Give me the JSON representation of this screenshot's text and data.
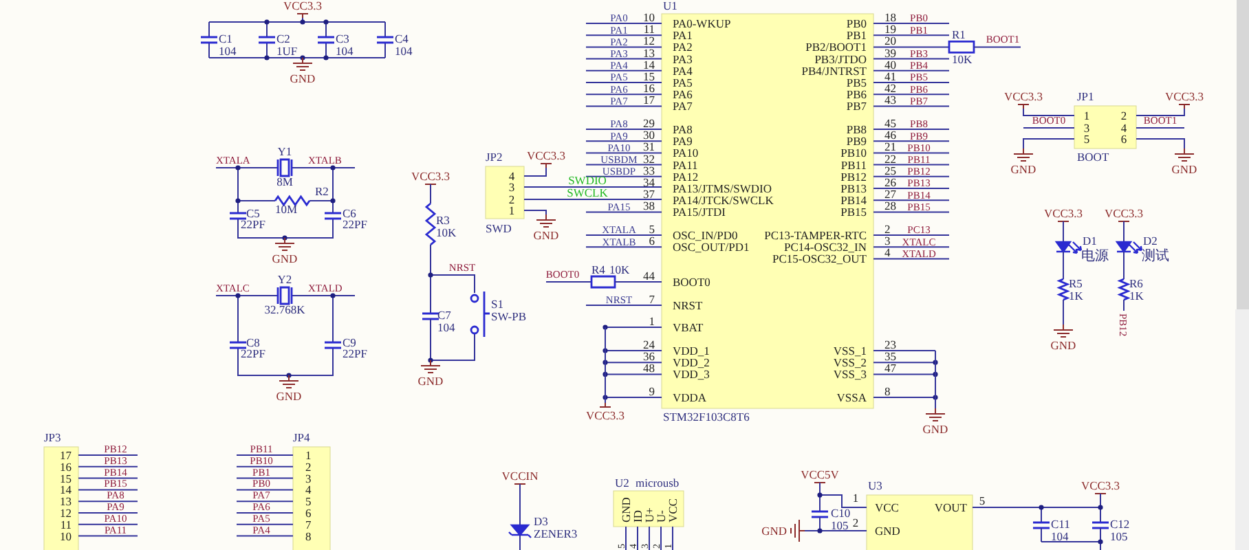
{
  "decoupling": {
    "supply": "VCC3.3",
    "ground": "GND",
    "capacitors": [
      {
        "ref": "C1",
        "value": "104"
      },
      {
        "ref": "C2",
        "value": "1UF"
      },
      {
        "ref": "C3",
        "value": "104"
      },
      {
        "ref": "C4",
        "value": "104"
      }
    ]
  },
  "oscillators": [
    {
      "nets": [
        "XTALA",
        "XTALB"
      ],
      "crystal": {
        "ref": "Y1",
        "value": "8M"
      },
      "resistor": {
        "ref": "R2",
        "value": "10M"
      },
      "capacitors": [
        {
          "ref": "C5",
          "value": "22PF"
        },
        {
          "ref": "C6",
          "value": "22PF"
        }
      ],
      "ground": "GND"
    },
    {
      "nets": [
        "XTALC",
        "XTALD"
      ],
      "crystal": {
        "ref": "Y2",
        "value": "32.768K"
      },
      "capacitors": [
        {
          "ref": "C8",
          "value": "22PF"
        },
        {
          "ref": "C9",
          "value": "22PF"
        }
      ],
      "ground": "GND"
    }
  ],
  "reset": {
    "supply": "VCC3.3",
    "resistor": {
      "ref": "R3",
      "value": "10K"
    },
    "net": "NRST",
    "capacitor": {
      "ref": "C7",
      "value": "104"
    },
    "switch": {
      "ref": "S1",
      "value": "SW-PB"
    },
    "ground": "GND"
  },
  "swd": {
    "ref": "JP2",
    "name": "SWD",
    "supply": "VCC3.3",
    "ground": "GND",
    "pins": [
      "4",
      "3",
      "2",
      "1"
    ],
    "nets": [
      "SWDIO",
      "SWCLK"
    ]
  },
  "mcu": {
    "ref": "U1",
    "part": "STM32F103C8T6",
    "supply": "VCC3.3",
    "ground": "GND",
    "left_groups": [
      [
        {
          "name": "PA0-WKUP",
          "number": "10",
          "net": "PA0"
        },
        {
          "name": "PA1",
          "number": "11",
          "net": "PA1"
        },
        {
          "name": "PA2",
          "number": "12",
          "net": "PA2"
        },
        {
          "name": "PA3",
          "number": "13",
          "net": "PA3"
        },
        {
          "name": "PA4",
          "number": "14",
          "net": "PA4"
        },
        {
          "name": "PA5",
          "number": "15",
          "net": "PA5"
        },
        {
          "name": "PA6",
          "number": "16",
          "net": "PA6"
        },
        {
          "name": "PA7",
          "number": "17",
          "net": "PA7"
        }
      ],
      [
        {
          "name": "PA8",
          "number": "29",
          "net": "PA8"
        },
        {
          "name": "PA9",
          "number": "30",
          "net": "PA9"
        },
        {
          "name": "PA10",
          "number": "31",
          "net": "PA10"
        },
        {
          "name": "PA11",
          "number": "32",
          "net": "USBDM"
        },
        {
          "name": "PA12",
          "number": "33",
          "net": "USBDP"
        },
        {
          "name": "PA13/JTMS/SWDIO",
          "number": "34"
        },
        {
          "name": "PA14/JTCK/SWCLK",
          "number": "37"
        },
        {
          "name": "PA15/JTDI",
          "number": "38",
          "net": "PA15"
        }
      ],
      [
        {
          "name": "OSC_IN/PD0",
          "number": "5",
          "net": "XTALA"
        },
        {
          "name": "OSC_OUT/PD1",
          "number": "6",
          "net": "XTALB"
        }
      ],
      [
        {
          "name": "BOOT0",
          "number": "44",
          "resistor": {
            "ref": "R4",
            "value": "10K",
            "net": "BOOT0"
          }
        }
      ],
      [
        {
          "name": "NRST",
          "number": "7",
          "net": "NRST"
        }
      ]
    ],
    "supply_pin_groups": [
      [
        {
          "name": "VBAT",
          "number": "1"
        }
      ],
      [
        {
          "name": "VDD_1",
          "number": "24"
        },
        {
          "name": "VDD_2",
          "number": "36"
        },
        {
          "name": "VDD_3",
          "number": "48"
        }
      ],
      [
        {
          "name": "VDDA",
          "number": "9"
        }
      ]
    ],
    "right_groups": [
      [
        {
          "name": "PB0",
          "number": "18",
          "net": "PB0"
        },
        {
          "name": "PB1",
          "number": "19",
          "net": "PB1"
        },
        {
          "name": "PB2/BOOT1",
          "number": "20",
          "resistor": {
            "ref": "R1",
            "value": "10K",
            "net": "BOOT1"
          }
        },
        {
          "name": "PB3/JTDO",
          "number": "39",
          "net": "PB3"
        },
        {
          "name": "PB4/JNTRST",
          "number": "40",
          "net": "PB4"
        },
        {
          "name": "PB5",
          "number": "41",
          "net": "PB5"
        },
        {
          "name": "PB6",
          "number": "42",
          "net": "PB6"
        },
        {
          "name": "PB7",
          "number": "43",
          "net": "PB7"
        }
      ],
      [
        {
          "name": "PB8",
          "number": "45",
          "net": "PB8"
        },
        {
          "name": "PB9",
          "number": "46",
          "net": "PB9"
        },
        {
          "name": "PB10",
          "number": "21",
          "net": "PB10"
        },
        {
          "name": "PB11",
          "number": "22",
          "net": "PB11"
        },
        {
          "name": "PB12",
          "number": "25",
          "net": "PB12"
        },
        {
          "name": "PB13",
          "number": "26",
          "net": "PB13"
        },
        {
          "name": "PB14",
          "number": "27",
          "net": "PB14"
        },
        {
          "name": "PB15",
          "number": "28",
          "net": "PB15"
        }
      ],
      [
        {
          "name": "PC13-TAMPER-RTC",
          "number": "2",
          "net": "PC13"
        },
        {
          "name": "PC14-OSC32_IN",
          "number": "3",
          "net": "XTALC"
        },
        {
          "name": "PC15-OSC32_OUT",
          "number": "4",
          "net": "XTALD"
        }
      ]
    ],
    "ground_pin_groups": [
      [
        {
          "name": "VSS_1",
          "number": "23"
        },
        {
          "name": "VSS_2",
          "number": "35"
        },
        {
          "name": "VSS_3",
          "number": "47"
        }
      ],
      [
        {
          "name": "VSSA",
          "number": "8"
        }
      ]
    ]
  },
  "boot_jumper": {
    "ref": "JP1",
    "name": "BOOT",
    "pins": [
      [
        "1",
        "2"
      ],
      [
        "3",
        "4"
      ],
      [
        "5",
        "6"
      ]
    ],
    "sides": [
      {
        "supply": "VCC3.3",
        "net": "BOOT0",
        "ground": "GND"
      },
      {
        "supply": "VCC3.3",
        "net": "BOOT1",
        "ground": "GND"
      }
    ]
  },
  "leds": [
    {
      "supply": "VCC3.3",
      "led": {
        "ref": "D1",
        "value": "电源"
      },
      "resistor": {
        "ref": "R5",
        "value": "1K"
      },
      "end": {
        "kind": "ground",
        "label": "GND"
      }
    },
    {
      "supply": "VCC3.3",
      "led": {
        "ref": "D2",
        "value": "测试"
      },
      "resistor": {
        "ref": "R6",
        "value": "1K"
      },
      "end": {
        "kind": "net",
        "label": "PB12"
      }
    }
  ],
  "headers": [
    {
      "ref": "JP3",
      "pins": [
        {
          "number": "17",
          "net": "PB12"
        },
        {
          "number": "16",
          "net": "PB13"
        },
        {
          "number": "15",
          "net": "PB14"
        },
        {
          "number": "14",
          "net": "PB15"
        },
        {
          "number": "13",
          "net": "PA8"
        },
        {
          "number": "12",
          "net": "PA9"
        },
        {
          "number": "11",
          "net": "PA10"
        },
        {
          "number": "10",
          "net": "PA11"
        }
      ]
    },
    {
      "ref": "JP4",
      "pins": [
        {
          "number": "1",
          "net": "PB11"
        },
        {
          "number": "2",
          "net": "PB10"
        },
        {
          "number": "3",
          "net": "PB1"
        },
        {
          "number": "4",
          "net": "PB0"
        },
        {
          "number": "5",
          "net": "PA7"
        },
        {
          "number": "6",
          "net": "PA6"
        },
        {
          "number": "7",
          "net": "PA5"
        },
        {
          "number": "8",
          "net": "PA4"
        }
      ]
    }
  ],
  "power_input": {
    "net": "VCCIN",
    "diode": {
      "ref": "D3",
      "value": "ZENER3"
    }
  },
  "usb": {
    "ref": "U2",
    "name": "microusb",
    "pins": [
      {
        "name": "GND",
        "number": "5"
      },
      {
        "name": "ID",
        "number": "4"
      },
      {
        "name": "U+",
        "number": "3"
      },
      {
        "name": "U-",
        "number": "2"
      },
      {
        "name": "VCC",
        "number": "1"
      }
    ]
  },
  "regulator": {
    "ref": "U3",
    "input": "VCC5V",
    "output": "VCC3.3",
    "ground": "GND",
    "pins": [
      {
        "name": "VCC",
        "number": "1"
      },
      {
        "name": "GND",
        "number": "2"
      },
      {
        "name": "VOUT",
        "number": "5"
      }
    ],
    "input_capacitor": {
      "ref": "C10",
      "value": "105"
    },
    "output_capacitors": [
      {
        "ref": "C11",
        "value": "104"
      },
      {
        "ref": "C12",
        "value": "105"
      }
    ]
  }
}
